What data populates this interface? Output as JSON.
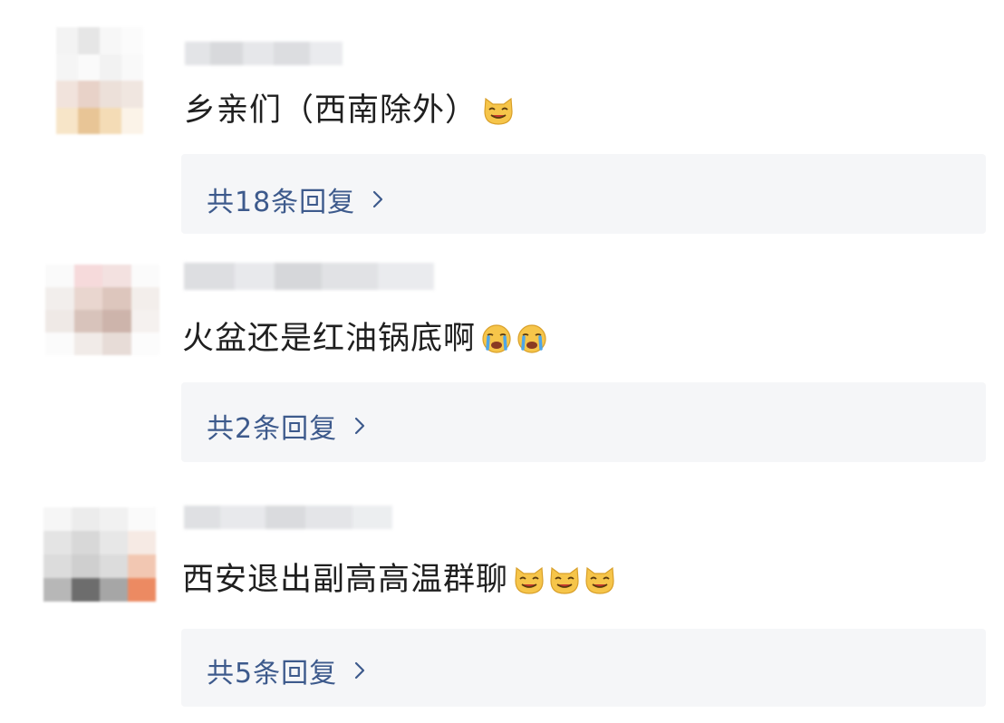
{
  "comments": [
    {
      "text": "乡亲们（西南除外）",
      "emojis": [
        "cat-grin-emoji"
      ],
      "reply_label": "共18条回复"
    },
    {
      "text": "火盆还是红油锅底啊",
      "emojis": [
        "cry-emoji",
        "cry-emoji"
      ],
      "reply_label": "共2条回复"
    },
    {
      "text": "西安退出副高高温群聊",
      "emojis": [
        "cat-grin-emoji",
        "cat-grin-emoji",
        "cat-grin-emoji"
      ],
      "reply_label": "共5条回复"
    }
  ],
  "icons": {
    "reply_chevron": "chevron-right-icon"
  },
  "colors": {
    "reply_link": "#3d5a8c",
    "reply_box_bg": "#f5f6f8",
    "comment_text": "#1f1f1f"
  }
}
